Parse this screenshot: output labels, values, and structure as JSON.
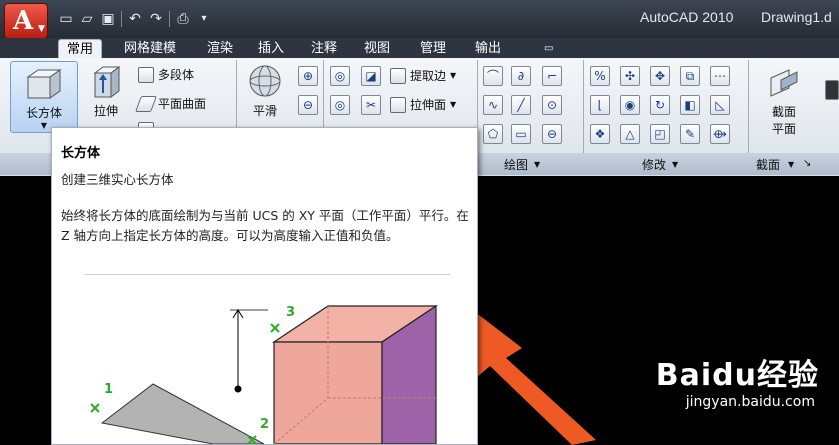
{
  "app": {
    "menu_letter": "A",
    "product": "AutoCAD 2010",
    "document": "Drawing1.d"
  },
  "quick_access": [
    "new-icon",
    "open-icon",
    "save-icon",
    "undo-icon",
    "redo-icon",
    "plot-icon"
  ],
  "tabs": [
    "常用",
    "网格建模",
    "渲染",
    "插入",
    "注释",
    "视图",
    "管理",
    "输出"
  ],
  "active_tab": "常用",
  "ribbon": {
    "modeling": {
      "box": "长方体",
      "extrude": "拉伸",
      "polysolid": "多段体",
      "planar_surface": "平面曲面",
      "partial_hidden": "……"
    },
    "mesh": {
      "smooth": "平滑"
    },
    "solid_edit": {
      "extract_edges": "提取边",
      "extrude_face": "拉伸面"
    },
    "panels": {
      "draw": "绘图",
      "modify": "修改",
      "section": "截面"
    },
    "section_plane": {
      "line1": "截面",
      "line2": "平面"
    }
  },
  "tooltip": {
    "title": "长方体",
    "subtitle": "创建三维实心长方体",
    "description": "始终将长方体的底面绘制为与当前 UCS 的 XY 平面（工作平面）平行。在 Z 轴方向上指定长方体的高度。可以为高度输入正值和负值。",
    "point_labels": [
      "1",
      "2",
      "3"
    ],
    "colors": {
      "box_front": "#eea79a",
      "box_side": "#9e62a8",
      "base": "#b3b3b3",
      "marker": "#2fa82f"
    }
  },
  "watermark": {
    "brand": "Baidu经验",
    "url": "jingyan.baidu.com"
  },
  "accent": {
    "arrow": "#ef5a24"
  }
}
